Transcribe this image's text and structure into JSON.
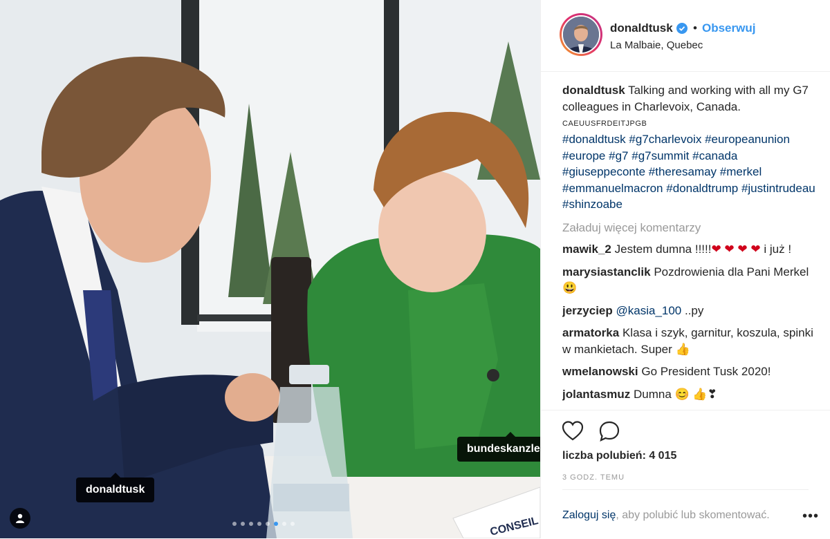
{
  "post": {
    "tags": [
      "donaldtusk",
      "bundeskanzlerin"
    ],
    "sign_text": "CONSEIL E"
  },
  "header": {
    "username": "donaldtusk",
    "follow_label": "Obserwuj",
    "bullet": "•",
    "location": "La Malbaie, Quebec"
  },
  "caption": {
    "username": "donaldtusk",
    "text": "Talking and working with all my G7 colleagues in Charlevoix, Canada.",
    "flags": "CAEUUSFRDEITJPGB",
    "hashtags": [
      "#donaldtusk",
      "#g7charlevoix",
      "#europeanunion",
      "#europe",
      "#g7",
      "#g7summit",
      "#canada",
      "#giuseppeconte",
      "#theresamay",
      "#merkel",
      "#emmanuelmacron",
      "#donaldtrump",
      "#justintrudeau",
      "#shinzoabe"
    ]
  },
  "load_more": "Załaduj więcej komentarzy",
  "comments": [
    {
      "user": "mawik_2",
      "text_before": "Jestem dumna !!!!!",
      "hearts": "❤ ❤ ❤ ❤",
      "text_after": "i już !"
    },
    {
      "user": "marysiastanclik",
      "text": "Pozdrowienia dla Pani Merkel 😃"
    },
    {
      "user": "jerzyciep",
      "mention": "@kasia_100",
      "text": " ..py"
    },
    {
      "user": "armatorka",
      "text": "Klasa i szyk, garnitur, koszula, spinki w mankietach. Super 👍"
    },
    {
      "user": "wmelanowski",
      "text": "Go President Tusk 2020!"
    },
    {
      "user": "jolantasmuz",
      "text": "Dumna 😊 👍❣"
    }
  ],
  "likes": "liczba polubień: 4 015",
  "timestamp": "3 GODZ. TEMU",
  "login": {
    "link": "Zaloguj się",
    "rest": ", aby polubić lub skomentować."
  },
  "more_label": "•••",
  "icons": [
    "heart-icon",
    "comment-icon",
    "verified-icon",
    "user-tag-icon"
  ],
  "colors": {
    "link": "#3897f0",
    "hashtag": "#003569",
    "muted": "#999999"
  }
}
